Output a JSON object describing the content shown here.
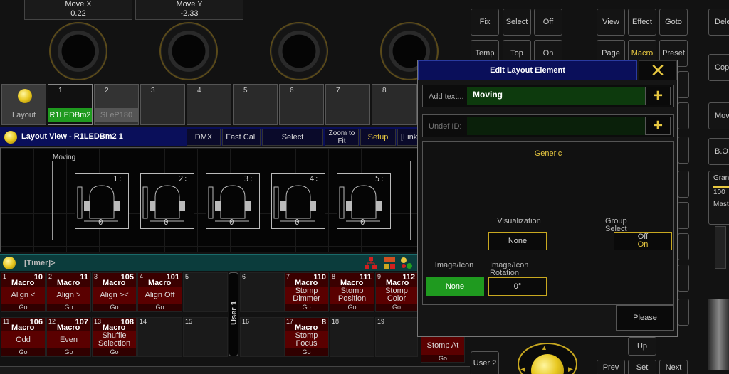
{
  "encoders": [
    {
      "name": "Move X",
      "value": "0.22"
    },
    {
      "name": "Move Y",
      "value": "-2.33"
    }
  ],
  "keys": {
    "fix": "Fix",
    "select": "Select",
    "off": "Off",
    "temp": "Temp",
    "top": "Top",
    "on": "On",
    "view": "View",
    "effect": "Effect",
    "goto": "Goto",
    "page": "Page",
    "macro": "Macro",
    "preset": "Preset",
    "up": "Up",
    "prev": "Prev",
    "set": "Set",
    "next": "Next",
    "user2": "User 2"
  },
  "side_keys": [
    "Dele",
    "Cop",
    "Mov",
    "B.O",
    "Gran",
    "100",
    "Mast"
  ],
  "view_buttons": [
    {
      "num": "",
      "label": "Layout"
    },
    {
      "num": "1",
      "label": "R1LEDBm2"
    },
    {
      "num": "2",
      "label": "SLeP180"
    },
    {
      "num": "3",
      "label": ""
    },
    {
      "num": "4",
      "label": ""
    },
    {
      "num": "5",
      "label": ""
    },
    {
      "num": "6",
      "label": ""
    },
    {
      "num": "7",
      "label": ""
    },
    {
      "num": "8",
      "label": ""
    }
  ],
  "layout_view": {
    "title": "Layout View - R1LEDBm2 1",
    "tabs": [
      "DMX",
      "Fast Call",
      "Select",
      "Zoom to Fit",
      "Setup",
      "[Link"
    ]
  },
  "canvas": {
    "group_label": "Moving",
    "fixtures": [
      {
        "id": "1:",
        "value": "0"
      },
      {
        "id": "2:",
        "value": "0"
      },
      {
        "id": "3:",
        "value": "0"
      },
      {
        "id": "4:",
        "value": "0"
      },
      {
        "id": "5:",
        "value": "0"
      }
    ]
  },
  "command_line": {
    "text": "[Timer]>"
  },
  "executors_row1": [
    {
      "num": "1",
      "kind": "Macro",
      "sub": "10",
      "name": "Align <",
      "go": "Go"
    },
    {
      "num": "2",
      "kind": "Macro",
      "sub": "11",
      "name": "Align >",
      "go": "Go"
    },
    {
      "num": "3",
      "kind": "Macro",
      "sub": "105",
      "name": "Align ><",
      "go": "Go"
    },
    {
      "num": "4",
      "kind": "Macro",
      "sub": "101",
      "name": "Align Off",
      "go": "Go"
    },
    {
      "num": "5",
      "kind": "",
      "sub": "",
      "name": "",
      "go": ""
    },
    {
      "num": "6",
      "kind": "",
      "sub": "",
      "name": "",
      "go": ""
    },
    {
      "num": "7",
      "kind": "Macro",
      "sub": "110",
      "name": "Stomp Dimmer",
      "go": "Go"
    },
    {
      "num": "8",
      "kind": "Macro",
      "sub": "111",
      "name": "Stomp Position",
      "go": "Go"
    },
    {
      "num": "9",
      "kind": "Macro",
      "sub": "112",
      "name": "Stomp Color",
      "go": "Go"
    }
  ],
  "executors_row2": [
    {
      "num": "11",
      "kind": "Macro",
      "sub": "106",
      "name": "Odd",
      "go": "Go"
    },
    {
      "num": "12",
      "kind": "Macro",
      "sub": "107",
      "name": "Even",
      "go": "Go"
    },
    {
      "num": "13",
      "kind": "Macro",
      "sub": "108",
      "name": "Shuffle Selection",
      "go": "Go"
    },
    {
      "num": "14",
      "kind": "",
      "sub": "",
      "name": "",
      "go": ""
    },
    {
      "num": "15",
      "kind": "",
      "sub": "",
      "name": "",
      "go": ""
    },
    {
      "num": "16",
      "kind": "",
      "sub": "",
      "name": "",
      "go": ""
    },
    {
      "num": "17",
      "kind": "Macro",
      "sub": "8",
      "name": "Stomp Focus",
      "go": "Go"
    },
    {
      "num": "18",
      "kind": "",
      "sub": "",
      "name": "",
      "go": ""
    },
    {
      "num": "19",
      "kind": "",
      "sub": "",
      "name": "",
      "go": ""
    },
    {
      "num": "",
      "kind": "",
      "sub": "",
      "name": "Stomp At",
      "go": "Go"
    }
  ],
  "user_divider": "User 1",
  "dialog": {
    "title": "Edit Layout Element",
    "text_label": "Add text...",
    "text_value": "Moving",
    "id_label": "Undef ID:",
    "id_value": "",
    "section": "Generic",
    "visualization_label": "Visualization",
    "visualization_value": "None",
    "group_select_label": "Group Select",
    "group_select_off": "Off",
    "group_select_on": "On",
    "image_icon_label": "Image/Icon",
    "image_icon_value": "None",
    "rotation_label": "Image/Icon Rotation",
    "rotation_value": "0°",
    "please": "Please"
  },
  "colors": {
    "accent": "#e8c840",
    "title_bar": "#0a0f5a",
    "executor": "#5a0000",
    "active_green": "#1f9a1f"
  }
}
